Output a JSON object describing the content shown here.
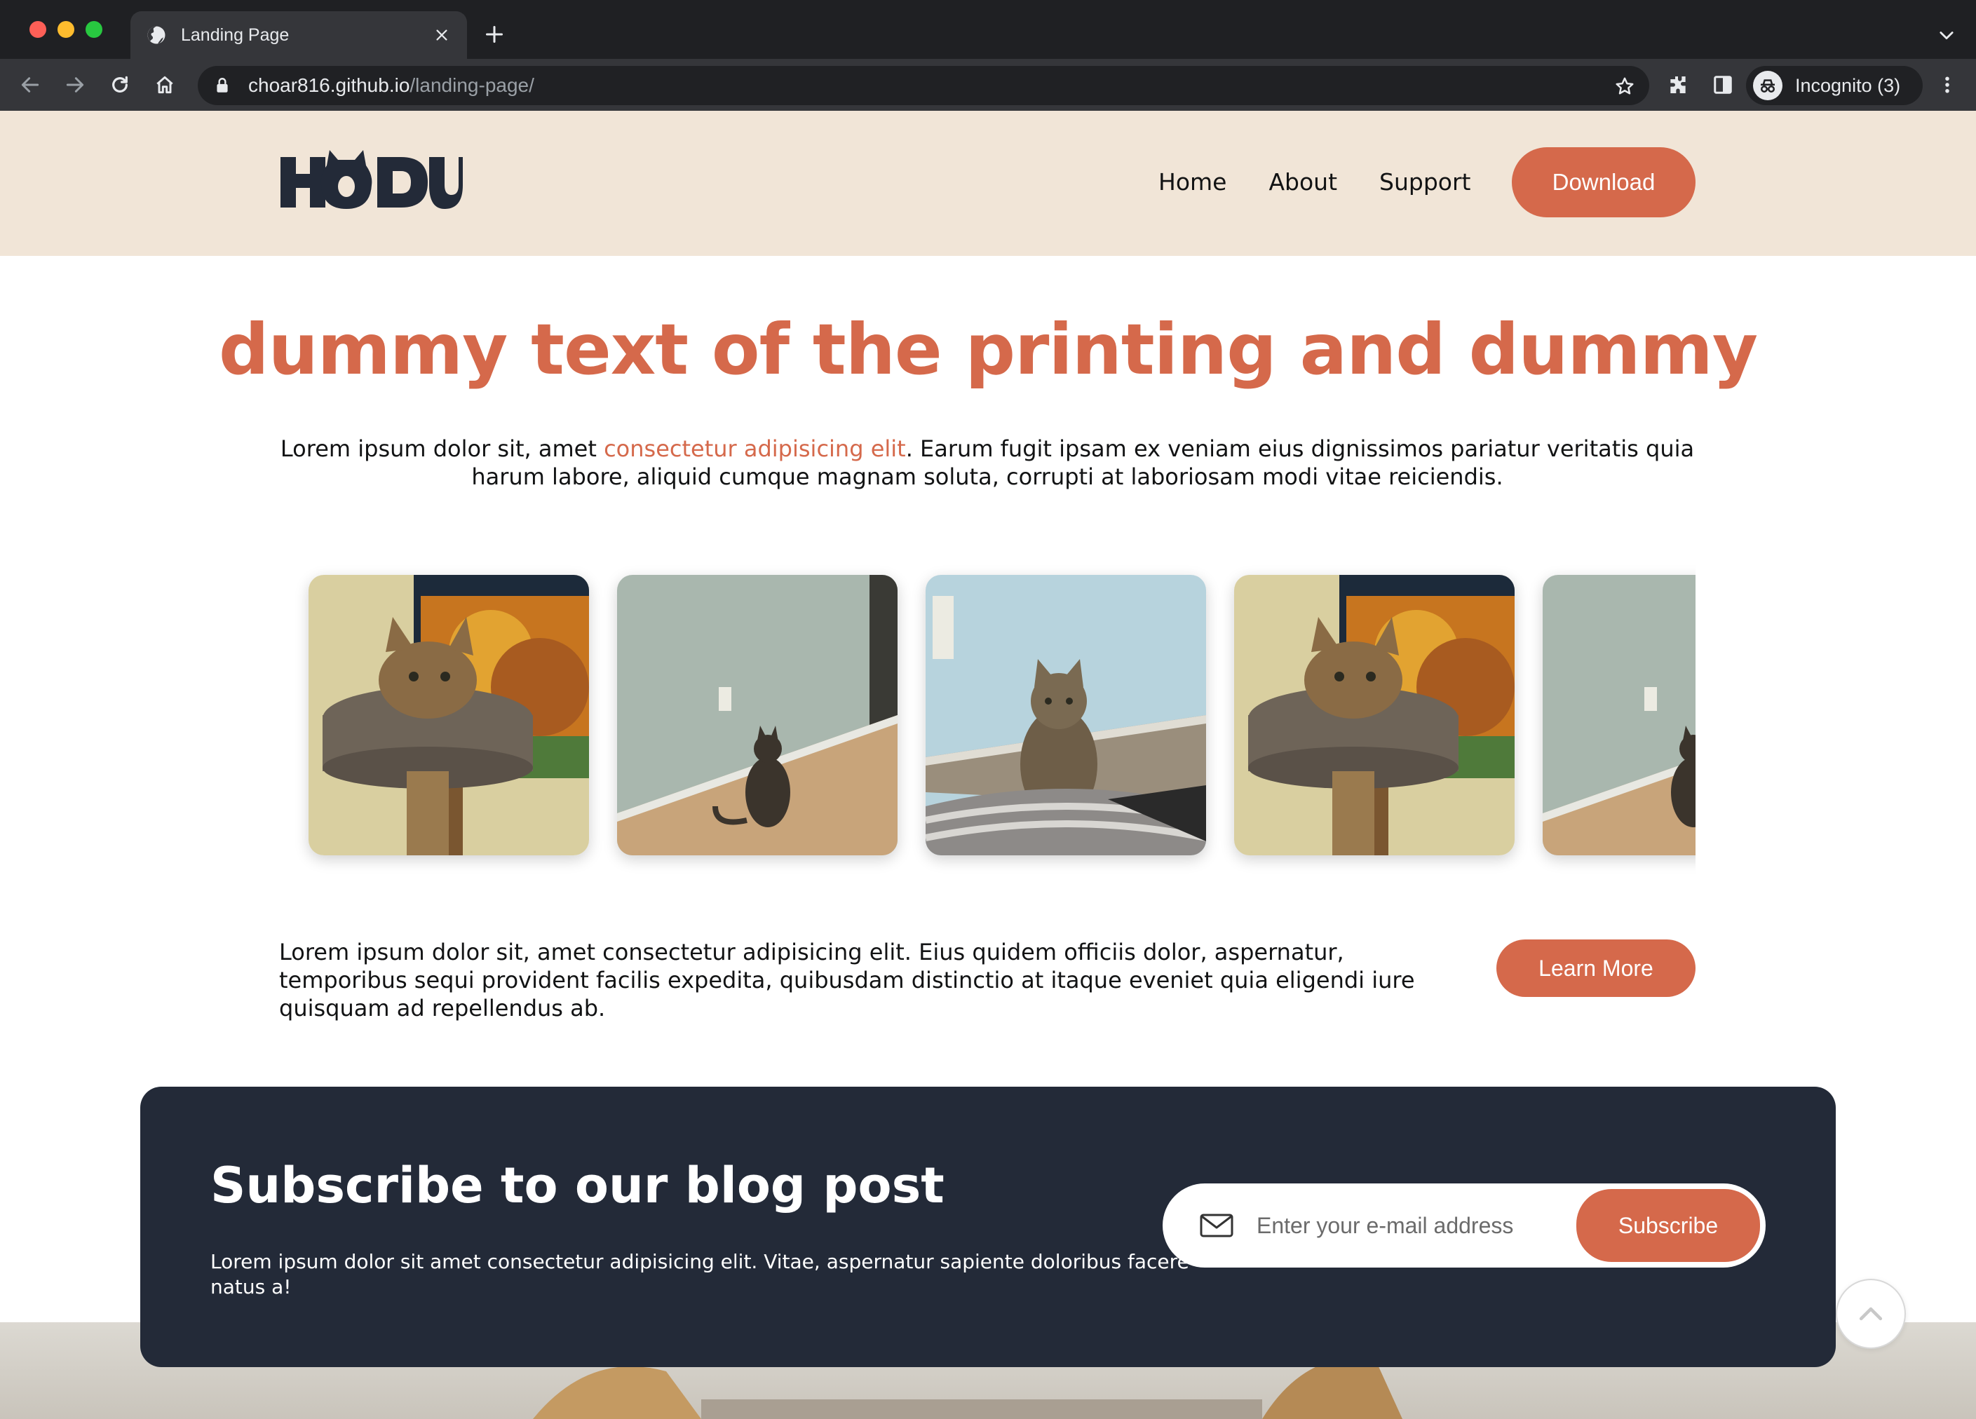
{
  "browser": {
    "tab_title": "Landing Page",
    "url_host": "choar816.github.io",
    "url_path": "/landing-page/",
    "profile_label": "Incognito (3)"
  },
  "header": {
    "logo_text": "HODU",
    "nav": [
      "Home",
      "About",
      "Support"
    ],
    "download_label": "Download"
  },
  "hero": {
    "title": "dummy text of the printing and dummy",
    "text_before": "Lorem ipsum dolor sit, amet ",
    "link_text": "consectetur adipisicing elit",
    "text_after": ". Earum fugit ipsam ex veniam eius dignissimos pariatur veritatis quia harum labore, aliquid cumque magnam soluta, corrupti at laboriosam modi vitae reiciendis."
  },
  "gallery": {
    "images": [
      "cat-on-scratching-post",
      "cat-facing-wall",
      "cat-sitting-on-rug",
      "cat-on-scratching-post",
      "cat-facing-wall"
    ]
  },
  "info": {
    "text": "Lorem ipsum dolor sit, amet consectetur adipisicing elit. Eius quidem officiis dolor, aspernatur, temporibus sequi provident facilis expedita, quibusdam distinctio at itaque eveniet quia eligendi iure quisquam ad repellendus ab.",
    "learn_more_label": "Learn More"
  },
  "subscribe": {
    "title": "Subscribe to our blog post",
    "text": "Lorem ipsum dolor sit amet consectetur adipisicing elit. Vitae, aspernatur sapiente doloribus facere natus a!",
    "email_placeholder": "Enter your e-mail address",
    "button_label": "Subscribe"
  },
  "colors": {
    "accent": "#d5694b",
    "header_bg": "#f1e5d7",
    "card_bg": "#232a38",
    "logo": "#232a38"
  },
  "icons": [
    "globe-icon",
    "close-icon",
    "plus-icon",
    "back-icon",
    "forward-icon",
    "reload-icon",
    "home-icon",
    "lock-icon",
    "star-icon",
    "puzzle-icon",
    "side-panel-icon",
    "incognito-icon",
    "kebab-menu-icon",
    "mail-icon",
    "chevron-up-icon"
  ]
}
